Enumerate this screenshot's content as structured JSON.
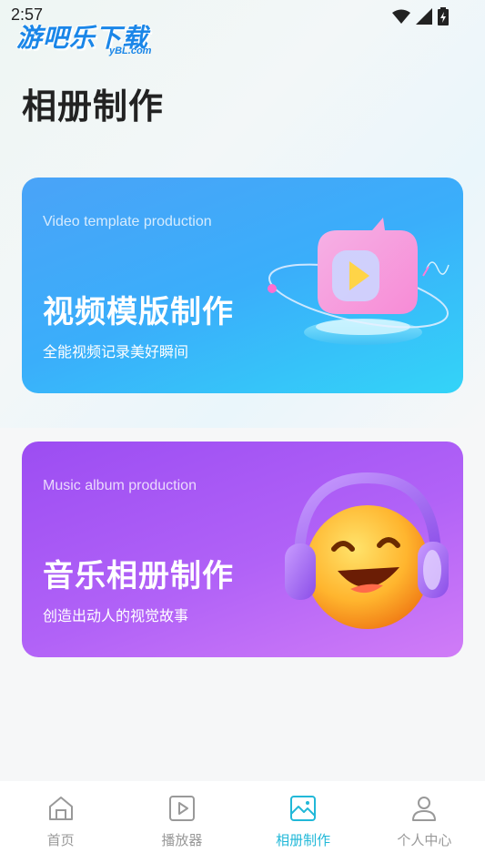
{
  "status_bar": {
    "time": "2:57"
  },
  "watermark": {
    "main": "游吧乐下载",
    "sub": "yBL.com"
  },
  "page_title": "相册制作",
  "cards": [
    {
      "en_title": "Video template production",
      "cn_title": "视频模版制作",
      "subtitle": "全能视频记录美好瞬间"
    },
    {
      "en_title": "Music album production",
      "cn_title": "音乐相册制作",
      "subtitle": "创造出动人的视觉故事"
    }
  ],
  "tabbar": {
    "items": [
      {
        "label": "首页",
        "icon": "home-icon"
      },
      {
        "label": "播放器",
        "icon": "play-icon"
      },
      {
        "label": "相册制作",
        "icon": "image-icon",
        "active": true
      },
      {
        "label": "个人中心",
        "icon": "person-icon"
      }
    ]
  },
  "colors": {
    "accent": "#21b8d8",
    "video_card": "#3aaefa",
    "music_card": "#a856f5"
  }
}
